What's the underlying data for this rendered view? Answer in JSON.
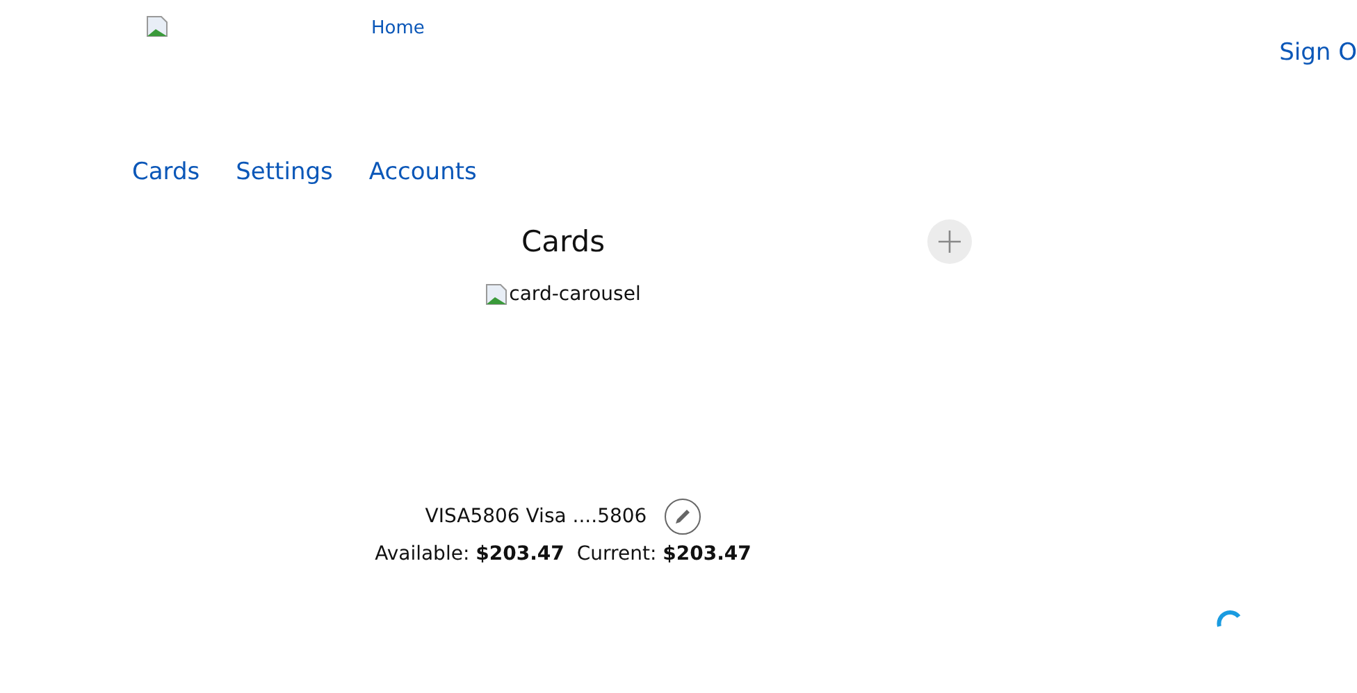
{
  "header": {
    "home_link": "Home",
    "sign_out": "Sign O"
  },
  "nav": [
    {
      "label": "Cards"
    },
    {
      "label": "Settings"
    },
    {
      "label": "Accounts"
    }
  ],
  "cards_section": {
    "title": "Cards",
    "carousel_alt": "card-carousel",
    "card_name": "VISA5806 Visa ....5806",
    "balances": [
      "Available: **$203.47**",
      "Current: **$203.47**"
    ],
    "loading": true
  }
}
